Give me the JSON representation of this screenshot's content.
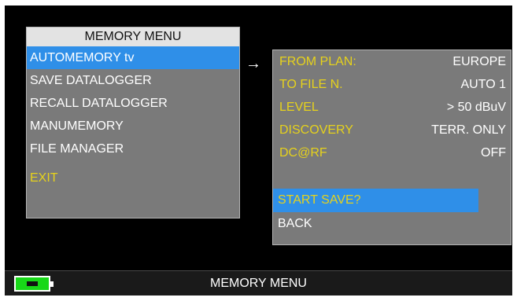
{
  "memory_menu": {
    "title": "MEMORY MENU",
    "items": [
      {
        "label": "AUTOMEMORY tv"
      },
      {
        "label": "SAVE DATALOGGER"
      },
      {
        "label": "RECALL DATALOGGER"
      },
      {
        "label": "MANUMEMORY"
      },
      {
        "label": "FILE MANAGER"
      }
    ],
    "exit_label": "EXIT"
  },
  "arrow": "→",
  "submenu": {
    "rows": [
      {
        "label": "FROM PLAN:",
        "value": "EUROPE"
      },
      {
        "label": "TO FILE N.",
        "value": "AUTO 1"
      },
      {
        "label": "LEVEL",
        "value": "> 50 dBuV"
      },
      {
        "label": "DISCOVERY",
        "value": "TERR. ONLY"
      },
      {
        "label": "DC@RF",
        "value": "OFF"
      }
    ],
    "start_save_label": "START SAVE?",
    "back_label": "BACK"
  },
  "status_bar": {
    "title": "MEMORY MENU",
    "battery_icon": "battery-charging-icon"
  },
  "colors": {
    "highlight": "#2f8fe8",
    "yellow_text": "#e6d21c",
    "panel": "#7a7a7a",
    "battery": "#18d818"
  }
}
